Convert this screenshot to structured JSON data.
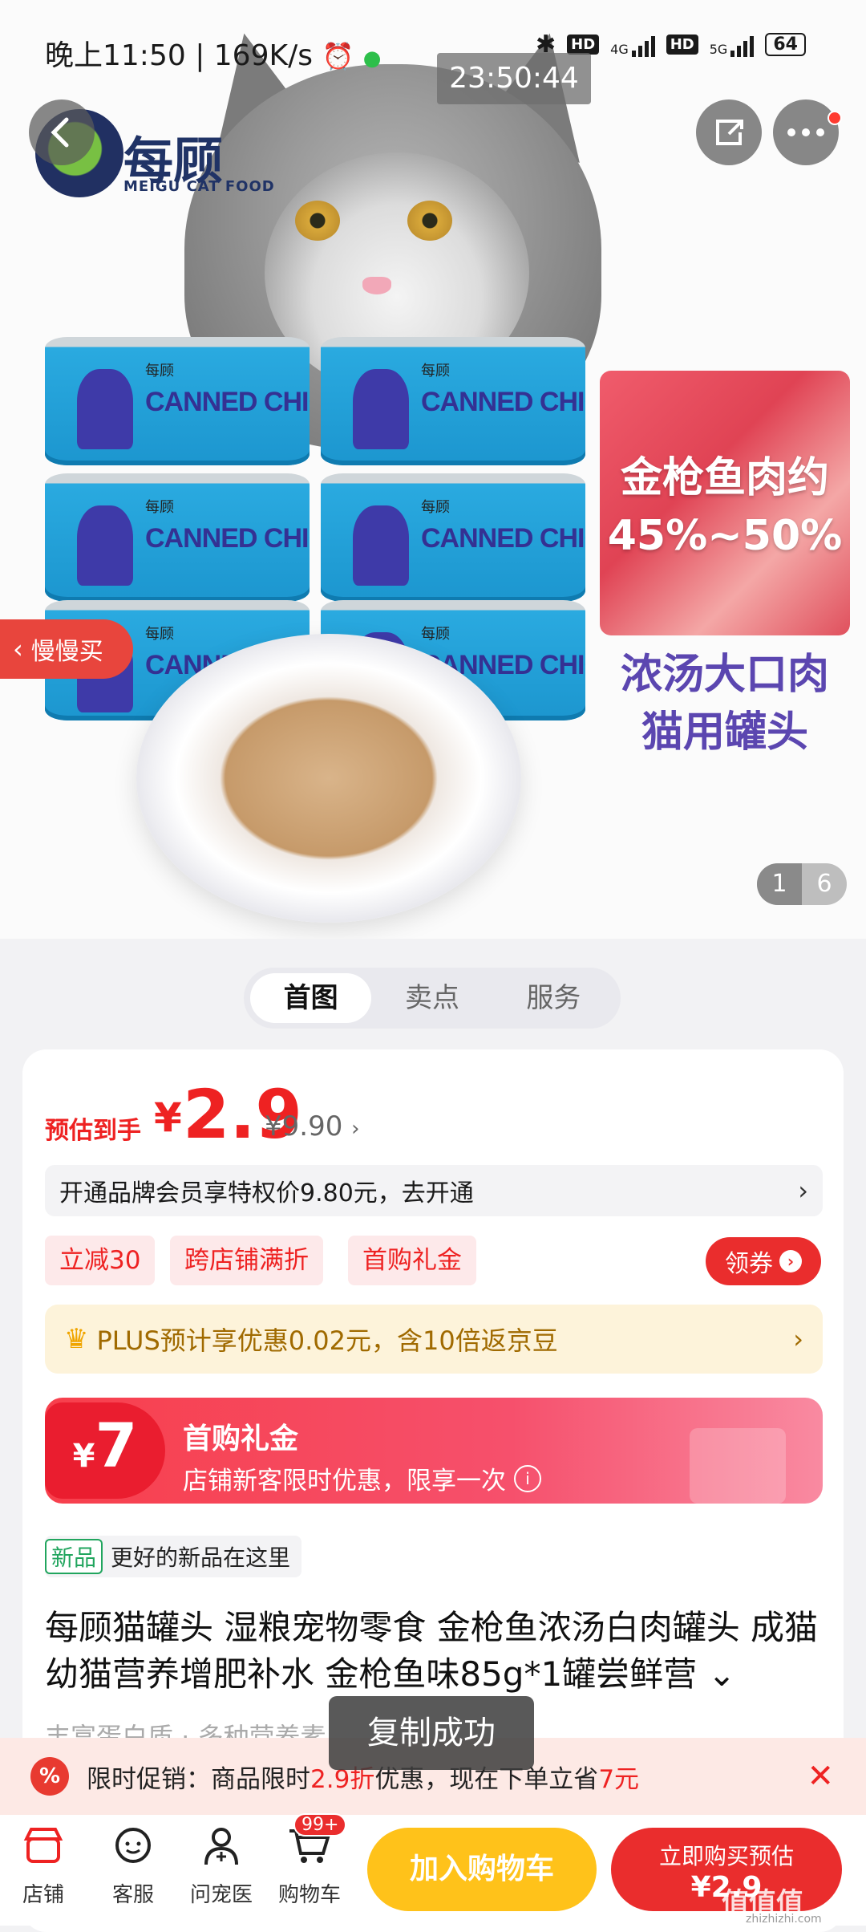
{
  "status": {
    "time": "晚上11:50",
    "speed": "169K/s",
    "net1": "4G",
    "net2": "5G",
    "hd": "HD",
    "battery": "64"
  },
  "timestamp_overlay": "23:50:44",
  "hero": {
    "brand_name": "每顾",
    "brand_sub": "MEIGU CAT FOOD",
    "can_text": "CANNED CHICKEN",
    "can_logo": "每顾",
    "tuna_line1": "金枪鱼肉约",
    "tuna_line2": "45%~50%",
    "side_line1": "浓汤大口肉",
    "side_line2": "猫用罐头",
    "slow_buy": "慢慢买",
    "image_index": "1",
    "image_total": "6"
  },
  "tabs": [
    {
      "label": "首图"
    },
    {
      "label": "卖点"
    },
    {
      "label": "服务"
    }
  ],
  "price": {
    "label": "预估到手",
    "currency": "¥",
    "amount": "2.9",
    "original": "¥9.90"
  },
  "member_offer": "开通品牌会员享特权价9.80元，去开通",
  "promo_tags": [
    "立减30",
    "跨店铺满折",
    "首购礼金"
  ],
  "coupon_button": "领券",
  "plus_offer": "PLUS预计享优惠0.02元，含10倍返京豆",
  "gift": {
    "amount_prefix": "¥",
    "amount": "7",
    "title": "首购礼金",
    "subtitle": "店铺新客限时优惠，限享一次"
  },
  "new_product": {
    "badge": "新品",
    "text": "更好的新品在这里"
  },
  "product_title": "每顾猫罐头 湿粮宠物零食 金枪鱼浓汤白肉罐头 成猫幼猫营养增肥补水 金枪鱼味85g*1罐尝鲜营 ⌄",
  "hidden_sub": "丰富蛋白质  ·  多种营养素",
  "promo_strip": {
    "prefix": "限时促销：商品限时",
    "discount": "2.9折",
    "middle": "优惠，现在下单立省",
    "save": "7元"
  },
  "toast": "复制成功",
  "bottom_nav": [
    {
      "label": "店铺",
      "icon": "shop-icon"
    },
    {
      "label": "客服",
      "icon": "chat-icon"
    },
    {
      "label": "问宠医",
      "icon": "vet-icon"
    },
    {
      "label": "购物车",
      "icon": "cart-icon"
    }
  ],
  "cart_count": "99+",
  "add_to_cart": "加入购物车",
  "buy_now": {
    "line1": "立即购买预估",
    "line2": "¥2.9"
  },
  "watermark": "值值值",
  "watermark_sub": "zhizhizhi.com"
}
